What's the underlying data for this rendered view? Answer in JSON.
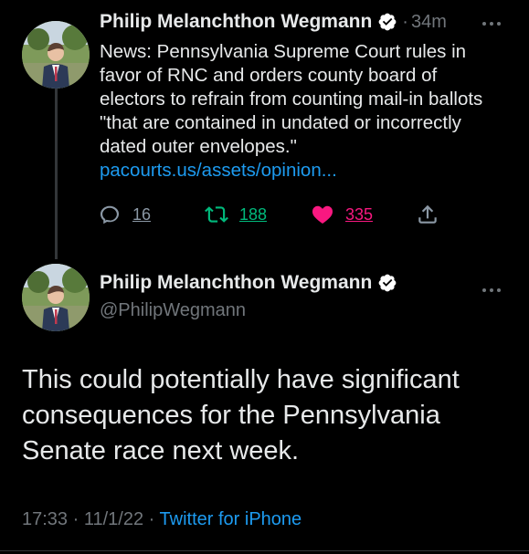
{
  "tweet1": {
    "author_name": "Philip Melanchthon Wegmann",
    "separator": "·",
    "timestamp": "34m",
    "text": "News: Pennsylvania Supreme Court rules in favor of RNC and orders county board of electors to refrain from counting mail-in ballots \"that are contained in undated or incorrectly dated outer envelopes.\"",
    "link": "pacourts.us/assets/opinion...",
    "replies": "16",
    "retweets": "188",
    "likes": "335",
    "more_icon": "more-dots-icon"
  },
  "tweet2": {
    "author_name": "Philip Melanchthon Wegmann",
    "handle": "@PhilipWegmann",
    "text": "This could potentially have significant consequences for the Pennsylvania Senate race next week.",
    "time": "17:33",
    "date": "11/1/22",
    "sep1": "·",
    "sep2": "·",
    "source": "Twitter for iPhone"
  },
  "colors": {
    "background": "#000000",
    "text": "#e7e9ea",
    "muted": "#71767b",
    "link": "#1d9bf0",
    "retweet": "#00ba7c",
    "like": "#f91880",
    "verified_badge": "#ffffff"
  }
}
